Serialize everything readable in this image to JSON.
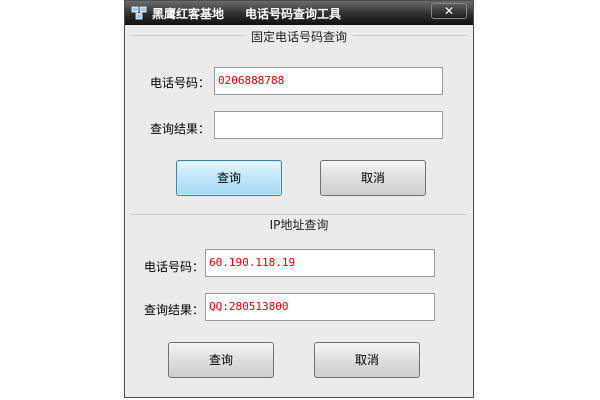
{
  "titlebar": {
    "app_name": "黑鹰红客基地",
    "window_title": "电话号码查询工具",
    "close_glyph": "✕"
  },
  "section1": {
    "title": "固定电话号码查询",
    "phone_label": "电话号码：",
    "phone_value": "0206888788",
    "result_label": "查询结果：",
    "result_value": "",
    "query_button": "查询",
    "cancel_button": "取消"
  },
  "section2": {
    "title": "IP地址查询",
    "phone_label": "电话号码：",
    "phone_value": "60.190.118.19",
    "result_label": "查询结果：",
    "result_value": "QQ:280513800",
    "query_button": "查询",
    "cancel_button": "取消"
  },
  "colors": {
    "field_text": "#e00000",
    "focus_button": "#bee6fd"
  },
  "icons": {
    "app": "network-computers-icon",
    "close": "close-icon"
  }
}
